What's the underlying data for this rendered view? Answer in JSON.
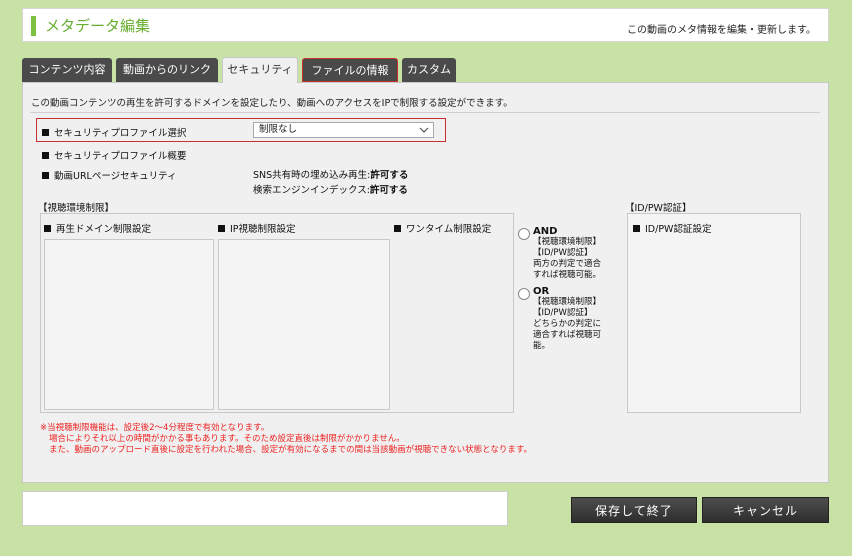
{
  "header": {
    "title": "メタデータ編集",
    "description": "この動画のメタ情報を編集・更新します。"
  },
  "tabs": [
    {
      "label": "コンテンツ内容"
    },
    {
      "label": "動画からのリンク"
    },
    {
      "label": "セキュリティ"
    },
    {
      "label": "ファイルの情報"
    },
    {
      "label": "カスタム"
    }
  ],
  "security": {
    "intro": "この動画コンテンツの再生を許可するドメインを設定したり、動画へのアクセスをIPで制限する設定ができます。",
    "profile_select_label": "セキュリティプロファイル選択",
    "profile_select_value": "制限なし",
    "profile_summary_label": "セキュリティプロファイル概要",
    "url_security_label": "動画URLページセキュリティ",
    "sns_prefix": "SNS共有時の埋め込み再生:",
    "sns_value": "許可する",
    "search_prefix": "検索エンジンインデックス:",
    "search_value": "許可する",
    "viewing_env_title": "【視聴環境制限】",
    "domain_restrict_label": "再生ドメイン制限設定",
    "ip_restrict_label": "IP視聴制限設定",
    "onetime_restrict_label": "ワンタイム制限設定",
    "and_title": "AND",
    "and_l1": "【視聴環境制限】",
    "and_l2": "【ID/PW認証】",
    "and_l3": "両方の判定で適合",
    "and_l4": "すれば視聴可能。",
    "or_title": "OR",
    "or_l1": "【視聴環境制限】",
    "or_l2": "【ID/PW認証】",
    "or_l3": "どちらかの判定に",
    "or_l4": "適合すれば視聴可",
    "or_l5": "能。",
    "idpw_title": "【ID/PW認証】",
    "idpw_setting_label": "ID/PW認証設定",
    "note1": "※当視聴制限機能は、設定後2～4分程度で有効となります。",
    "note2": "場合によりそれ以上の時間がかかる事もあります。そのため設定直後は制限がかかりません。",
    "note3": "また、動画のアップロード直後に設定を行われた場合、設定が有効になるまでの間は当該動画が視聴できない状態となります。"
  },
  "buttons": {
    "save_label": "保存して終了",
    "cancel_label": "キャンセル"
  },
  "colors": {
    "background": "#c8e2a6",
    "accent": "#7cc142",
    "highlight": "#c8302f",
    "note_text": "#ee2222"
  }
}
